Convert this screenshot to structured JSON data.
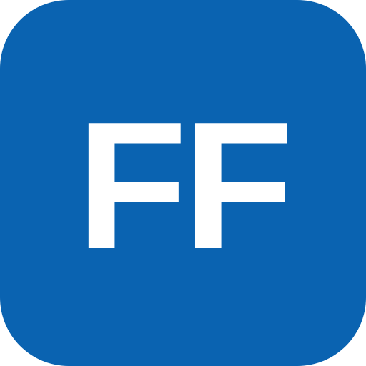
{
  "icon": {
    "text": "FF",
    "background_color": "#0a63b1",
    "text_color": "#ffffff"
  }
}
